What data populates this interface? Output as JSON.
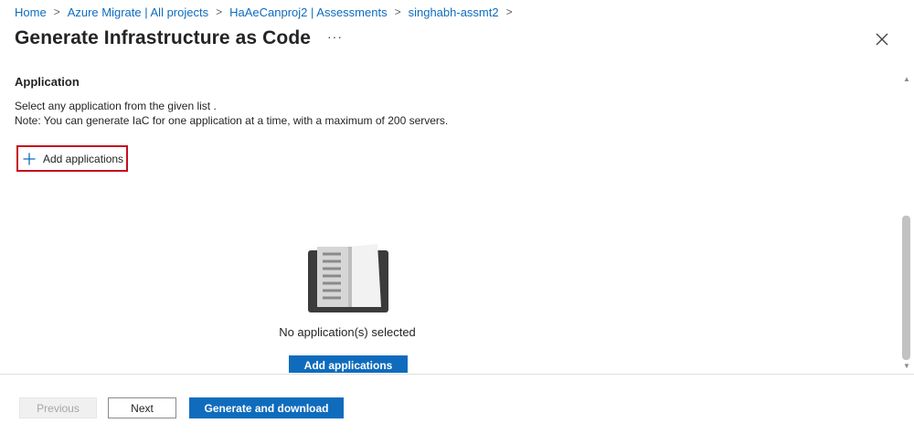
{
  "breadcrumb": {
    "items": [
      "Home",
      "Azure Migrate | All projects",
      "HaAeCanproj2 | Assessments",
      "singhabh-assmt2"
    ],
    "separator": ">"
  },
  "header": {
    "title": "Generate Infrastructure as Code",
    "more": "···"
  },
  "application": {
    "section_title": "Application",
    "desc_line1": "Select any application from the given list .",
    "desc_line2": "Note: You can generate IaC for one application at a time, with a maximum of 200 servers.",
    "add_link_label": "Add applications",
    "empty_text": "No application(s) selected",
    "add_button_label": "Add applications"
  },
  "footer": {
    "previous": "Previous",
    "next": "Next",
    "generate": "Generate and download"
  },
  "icons": {
    "plus": "plus-icon",
    "close": "close-icon",
    "book": "book-icon"
  },
  "colors": {
    "accent": "#0f6cbd",
    "highlight_border": "#c50f1f",
    "disabled_text": "#a6a6a6"
  }
}
